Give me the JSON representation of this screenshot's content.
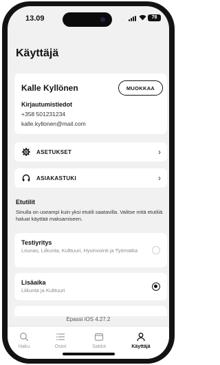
{
  "status_bar": {
    "time": "13.09",
    "battery": "78",
    "signal_icon": "cellular-signal-icon",
    "wifi_icon": "wifi-icon"
  },
  "page": {
    "title": "Käyttäjä"
  },
  "profile": {
    "name": "Kalle Kyllönen",
    "edit_label": "MUOKKAA",
    "login_heading": "Kirjautumistiedot",
    "phone": "+358 501231234",
    "email": "kalle.kyllonen@mail.com"
  },
  "menu": [
    {
      "label": "ASETUKSET",
      "icon": "gear-icon"
    },
    {
      "label": "ASIAKASTUKI",
      "icon": "headphones-icon"
    }
  ],
  "benefits_section": {
    "title": "Etutilit",
    "description": "Sinulla on useampi kuin yksi etutili saatavilla. Valitse mitä etutiliä haluat käyttää maksamiseen.",
    "items": [
      {
        "name": "Testiyritys",
        "description": "Lounas, Liikunta, Kulttuuri, Hyvinvointi ja Työmatka",
        "selected": false
      },
      {
        "name": "Lisäaika",
        "description": "Liikunta ja Kulttuuri",
        "selected": true
      }
    ]
  },
  "version": "Epassi iOS 4.27.2",
  "tabbar": {
    "tabs": [
      {
        "label": "Haku",
        "icon": "search-icon",
        "active": false
      },
      {
        "label": "Ostot",
        "icon": "list-icon",
        "active": false
      },
      {
        "label": "Saldot",
        "icon": "wallet-icon",
        "active": false
      },
      {
        "label": "Käyttäjä",
        "icon": "user-icon",
        "active": true
      }
    ]
  },
  "colors": {
    "background": "#f1f1f1",
    "card": "#ffffff",
    "text": "#111111",
    "muted": "#8a8a8a"
  }
}
